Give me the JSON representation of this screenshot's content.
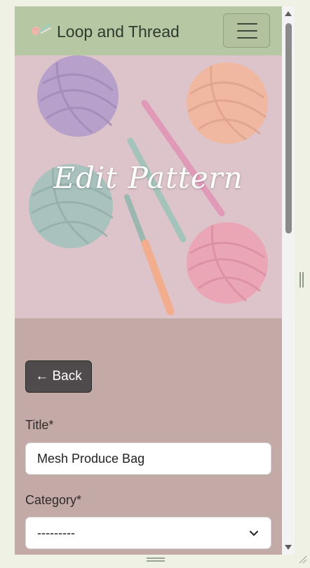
{
  "navbar": {
    "brand_name": "Loop and Thread",
    "menu_icon": "hamburger-icon",
    "logo_icon": "yarn-logo-icon"
  },
  "hero": {
    "title": "Edit Pattern"
  },
  "form": {
    "back_label": "← Back",
    "title_label": "Title*",
    "title_value": "Mesh Produce Bag",
    "category_label": "Category*",
    "category_value": "---------"
  },
  "colors": {
    "navbar_bg": "#b6c7a3",
    "content_bg": "#c4aaa6",
    "hero_bg": "#ddc6cc",
    "back_button_bg": "#4f4a4b"
  }
}
